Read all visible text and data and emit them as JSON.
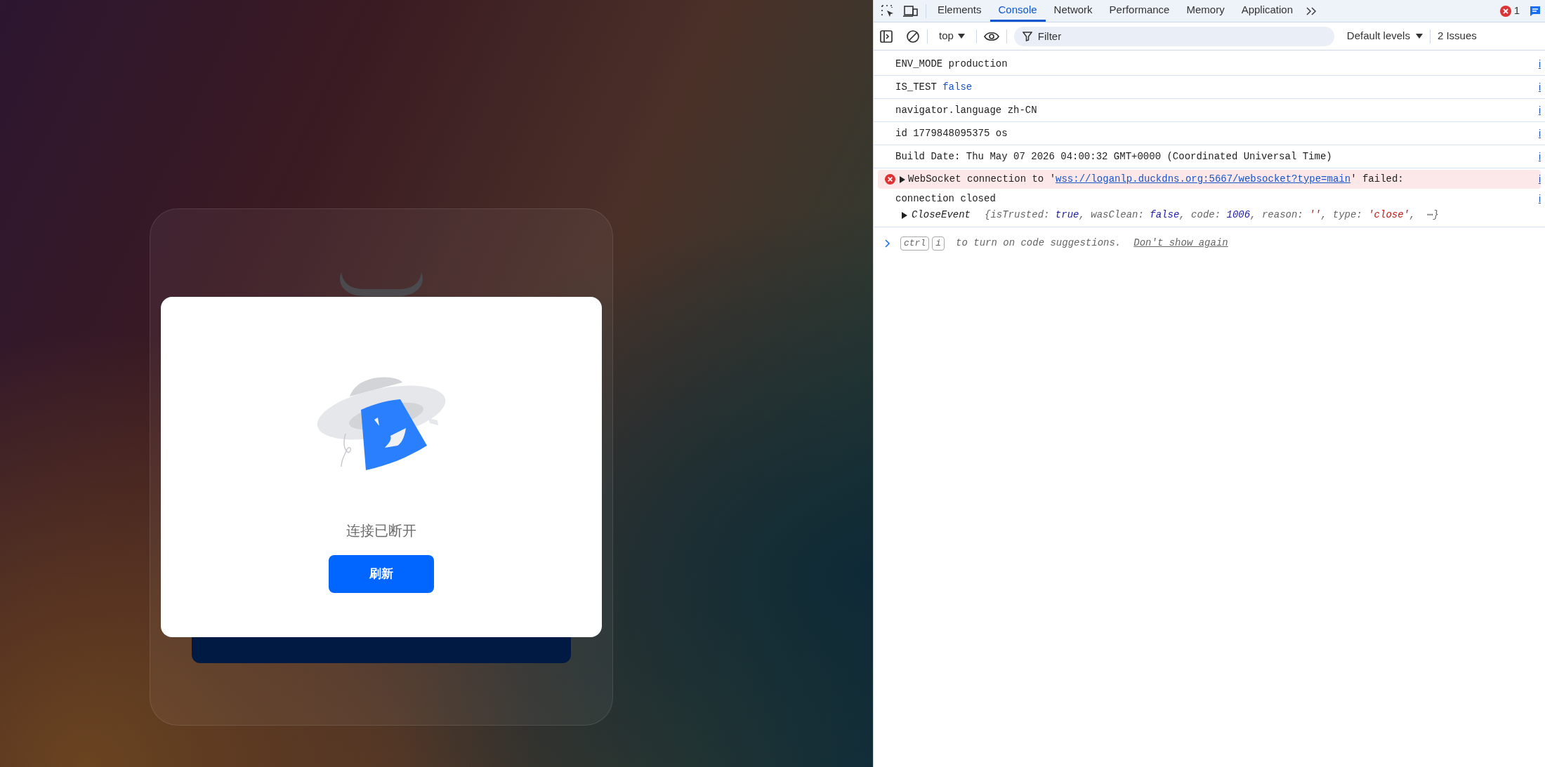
{
  "app": {
    "dialog": {
      "message": "连接已断开",
      "button": "刷新"
    }
  },
  "devtools": {
    "tabs": [
      {
        "label": "Elements",
        "selected": false
      },
      {
        "label": "Console",
        "selected": true
      },
      {
        "label": "Network",
        "selected": false
      },
      {
        "label": "Performance",
        "selected": false
      },
      {
        "label": "Memory",
        "selected": false
      },
      {
        "label": "Application",
        "selected": false
      }
    ],
    "error_count": "1",
    "toolbar": {
      "context": "top",
      "filter_placeholder": "Filter",
      "levels": "Default levels",
      "issues": "2 Issues"
    },
    "messages": [
      {
        "kind": "log",
        "text": "ENV_MODE production",
        "source": "i"
      },
      {
        "kind": "log",
        "text": "IS_TEST",
        "value": "false",
        "source": "i"
      },
      {
        "kind": "log",
        "text": "navigator.language zh-CN",
        "source": "i"
      },
      {
        "kind": "log",
        "text": "id 1779848095375 os",
        "source": "i"
      },
      {
        "kind": "log",
        "text": "Build Date: Thu May 07 2026 04:00:32 GMT+0000 (Coordinated Universal Time)",
        "source": "i"
      },
      {
        "kind": "error",
        "before": "WebSocket connection to '",
        "url": "wss://loganlp.duckdns.org:5667/websocket?type=main",
        "after": "' failed:",
        "source": "i"
      },
      {
        "kind": "object",
        "text": "connection closed",
        "source": "i",
        "object_name": "CloseEvent",
        "preview": [
          {
            "text": "{isTrusted: ",
            "kind": "key"
          },
          {
            "text": "true",
            "kind": "literal"
          },
          {
            "text": ", wasClean: ",
            "kind": "key"
          },
          {
            "text": "false",
            "kind": "literal"
          },
          {
            "text": ", code: ",
            "kind": "key"
          },
          {
            "text": "1006",
            "kind": "literal"
          },
          {
            "text": ", reason: ",
            "kind": "key"
          },
          {
            "text": "''",
            "kind": "string"
          },
          {
            "text": ", type: ",
            "kind": "key"
          },
          {
            "text": "'close'",
            "kind": "string"
          },
          {
            "text": ",  ⋯}",
            "kind": "key"
          }
        ]
      }
    ],
    "hint": {
      "keys": [
        "ctrl",
        "i"
      ],
      "text": "to turn on code suggestions.",
      "link": "Don't show again"
    }
  }
}
